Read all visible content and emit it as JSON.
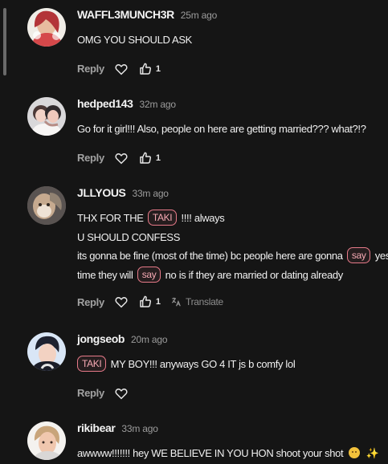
{
  "icons": {
    "heart": "heart-outline-icon",
    "thumb": "thumb-up-outline-icon",
    "translate": "translate-icon",
    "smile": "smiling-face-emoji",
    "sparkles": "sparkles-emoji"
  },
  "colors": {
    "background": "#151515",
    "tag_border": "#e77a89",
    "tag_text": "#f5a9b3",
    "muted": "#9b9b9b"
  },
  "comments": [
    {
      "username": "WAFFL3MUNCH3R",
      "time": "25m ago",
      "lines": [
        "OMG YOU SHOULD ASK"
      ],
      "reply": "Reply",
      "likes": "1"
    },
    {
      "username": "hedped143",
      "time": "32m ago",
      "lines": [
        "Go for it girl!!! Also, people on here are getting married??? what?!?"
      ],
      "reply": "Reply",
      "likes": "1"
    },
    {
      "username": "JLLYOUS",
      "time": "33m ago",
      "line1_before": "THX FOR THE",
      "line1_tag": "TAKI",
      "line1_after": "!!!! always",
      "line2": "U SHOULD CONFESS",
      "line3_before": "its gonna be fine (most of the time) bc people here are gonna",
      "line3_tag": "say",
      "line3_after": "yes",
      "line4_before": "time they will",
      "line4_tag": "say",
      "line4_after": "no is if they are married or dating already",
      "reply": "Reply",
      "likes": "1",
      "translate": "Translate"
    },
    {
      "username": "jongseob",
      "time": "20m ago",
      "line1_tag": "TAKI",
      "line1_after": "MY BOY!!! anyways GO 4 IT js b comfy lol",
      "reply": "Reply"
    },
    {
      "username": "rikibear",
      "time": "33m ago",
      "line1": "awwww!!!!!!! hey WE BELIEVE IN YOU HON shoot your shot"
    }
  ]
}
